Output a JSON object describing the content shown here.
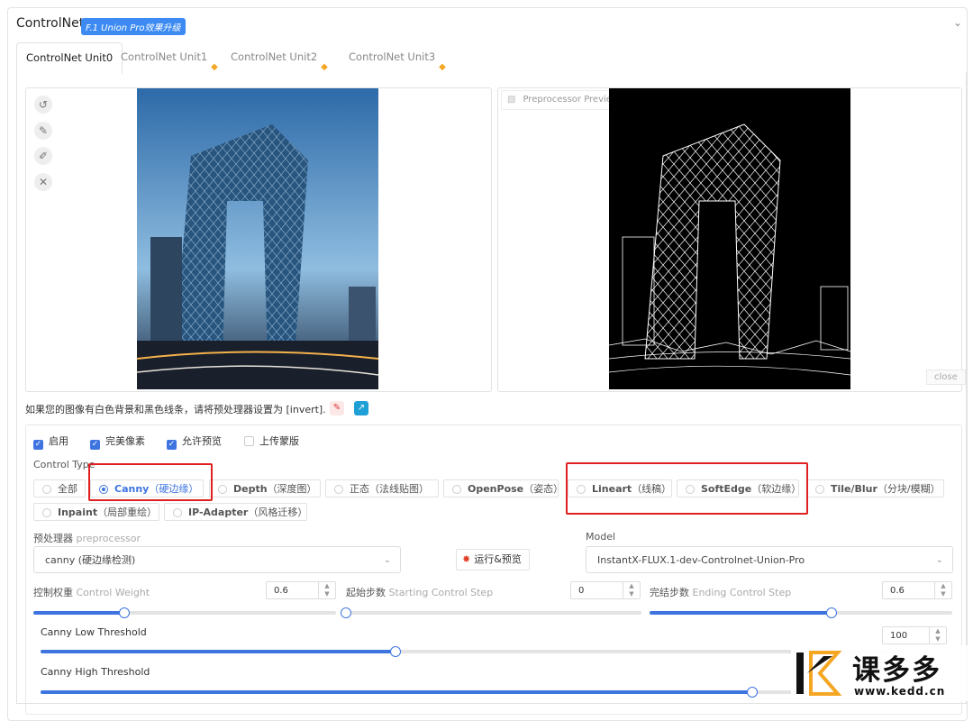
{
  "header": {
    "title": "ControlNet",
    "badge": "F.1 Union Pro效果升级"
  },
  "tabs": [
    {
      "label": "ControlNet Unit0",
      "active": true
    },
    {
      "label": "ControlNet Unit1"
    },
    {
      "label": "ControlNet Unit2"
    },
    {
      "label": "ControlNet Unit3"
    }
  ],
  "preview": {
    "label": "Preprocessor Preview",
    "close_label": "close"
  },
  "hint": "如果您的图像有白色背景和黑色线条，请将预处理器设置为 [invert].",
  "checkboxes": [
    {
      "label": "启用",
      "checked": true
    },
    {
      "label": "完美像素",
      "checked": true
    },
    {
      "label": "允许预览",
      "checked": true
    },
    {
      "label": "上传蒙版",
      "checked": false
    }
  ],
  "control_type": {
    "label": "Control Type",
    "options": [
      {
        "label": "全部"
      },
      {
        "label": "Canny",
        "sub": "（硬边缘）",
        "selected": true
      },
      {
        "label": "Depth",
        "sub": "（深度图）"
      },
      {
        "label": "正态",
        "sub": "（法线贴图）"
      },
      {
        "label": "OpenPose",
        "sub": "（姿态）"
      },
      {
        "label": "Lineart",
        "sub": "（线稿）"
      },
      {
        "label": "SoftEdge",
        "sub": "（软边缘）"
      },
      {
        "label": "Tile/Blur",
        "sub": "（分块/模糊）"
      },
      {
        "label": "Inpaint",
        "sub": "（局部重绘）"
      },
      {
        "label": "IP-Adapter",
        "sub": "（风格迁移）"
      }
    ]
  },
  "preprocessor": {
    "label_cn": "预处理器",
    "label_en": "preprocessor",
    "value": "canny (硬边缘检测)"
  },
  "run_button": "运行&预览",
  "model": {
    "label": "Model",
    "value": "InstantX-FLUX.1-dev-Controlnet-Union-Pro"
  },
  "control_weight": {
    "label_cn": "控制权重",
    "label_en": "Control Weight",
    "value": "0.6",
    "fraction": 0.3
  },
  "start_step": {
    "label_cn": "起始步数",
    "label_en": "Starting Control Step",
    "value": "0",
    "fraction": 0.0
  },
  "end_step": {
    "label_cn": "完结步数",
    "label_en": "Ending Control Step",
    "value": "0.6",
    "fraction": 0.6
  },
  "canny_low": {
    "label": "Canny Low Threshold",
    "value": "100",
    "fraction": 0.41
  },
  "canny_high": {
    "label": "Canny High Threshold",
    "fraction": 0.84
  },
  "watermark": {
    "brand": "课多多",
    "url": "www.kedd.cn"
  },
  "colors": {
    "accent": "#3d74e0",
    "highlight_box": "#e02020",
    "badge": "#3d8bf2"
  }
}
